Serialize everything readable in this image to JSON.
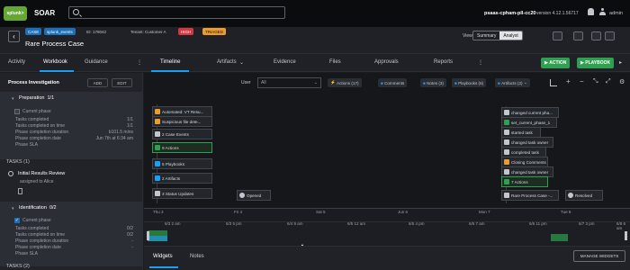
{
  "topbar": {
    "logo_text": "splunk>",
    "app_name": "SOAR",
    "search_placeholder": "",
    "server_name": "psaas-cpham-pll-cc20",
    "version": "version 4.12.1.56717",
    "user": "admin"
  },
  "header": {
    "case_badge": "CASE",
    "label_badge": "splunk_events",
    "id_text": "ID: 178042",
    "tenant_text": "Tenant: Customer A",
    "severity": "HIGH",
    "status": "TRIAGED",
    "title": "Rare Process Case",
    "view_label": "View",
    "view_summary": "Summary",
    "view_analyst": "Analyst"
  },
  "left_tabs": [
    "Activity",
    "Workbook",
    "Guidance"
  ],
  "main_tabs": [
    "Timeline",
    "Artifacts",
    "Evidence",
    "Files",
    "Approvals",
    "Reports"
  ],
  "action_button": "ACTION",
  "playbook_button": "PLAYBOOK",
  "workbook": {
    "title": "Process Investigation",
    "add_label": "ADD",
    "edit_label": "EDIT",
    "phases": [
      {
        "name": "Preparation",
        "count": "1/1",
        "current_phase": "Current phase",
        "rows": [
          {
            "label": "Tasks completed",
            "value": "1/1"
          },
          {
            "label": "Tasks completed on time",
            "value": "1/1"
          },
          {
            "label": "Phase completion duration",
            "value": "b101.5 mins"
          },
          {
            "label": "Phase completion date",
            "value": "Jun 7th at 6:34 am"
          },
          {
            "label": "Phase SLA",
            "value": ""
          }
        ]
      },
      {
        "name": "Identification",
        "count": "0/2",
        "current_phase": "Current phase",
        "rows": [
          {
            "label": "Tasks completed",
            "value": "0/2"
          },
          {
            "label": "Tasks completed on time",
            "value": "0/2"
          },
          {
            "label": "Phase completion duration",
            "value": "-"
          },
          {
            "label": "Phase completion date",
            "value": "-"
          },
          {
            "label": "Phase SLA",
            "value": ""
          }
        ]
      }
    ],
    "tasks_header": "TASKS (1)",
    "task_name": "Initial Results Review",
    "task_assignee": "assigned to Alice",
    "tasks_header2": "TASKS (2)"
  },
  "timeline": {
    "user_label": "User",
    "user_select": "All",
    "filters": [
      "Actions (17)",
      "Comments",
      "Notes (3)",
      "Playbooks (6)",
      "Artifacts (2)"
    ],
    "events_col1": [
      "Automated: VT Resu...",
      "Suspicious file dete...",
      "2 Case Events",
      "9 Actions",
      "5 Playbooks",
      "2 Artifacts",
      "3 Status Updates"
    ],
    "opened": "Opened",
    "events_col2": [
      "changed current pha...",
      "set_current_phase_1",
      "started task",
      "changed task owner",
      "completed task",
      "Closing Comments",
      "changed task owner",
      "7 Actions",
      "Rare Process Case -..."
    ],
    "resolved": "Resolved",
    "axis_days": [
      "Thu 3",
      "Fri 4",
      "Sat 5",
      "Jun 6",
      "Mon 7",
      "Tue 8"
    ],
    "mini_axis": [
      "6/3 2 am",
      "6/3 5 pm",
      "6/4 9 am",
      "6/5 12 am",
      "6/5 4 pm",
      "6/6 7 am",
      "6/6 11 pm",
      "6/7 3 pm",
      "6/8 6 am"
    ]
  },
  "bottom": {
    "tab_widgets": "Widgets",
    "tab_notes": "Notes",
    "manage_widgets": "MANAGE WIDGETS"
  },
  "colors": {
    "accent": "#1b9ff2",
    "green": "#2ea04f",
    "high": "#d6363f",
    "triaged": "#ec9b2f"
  }
}
